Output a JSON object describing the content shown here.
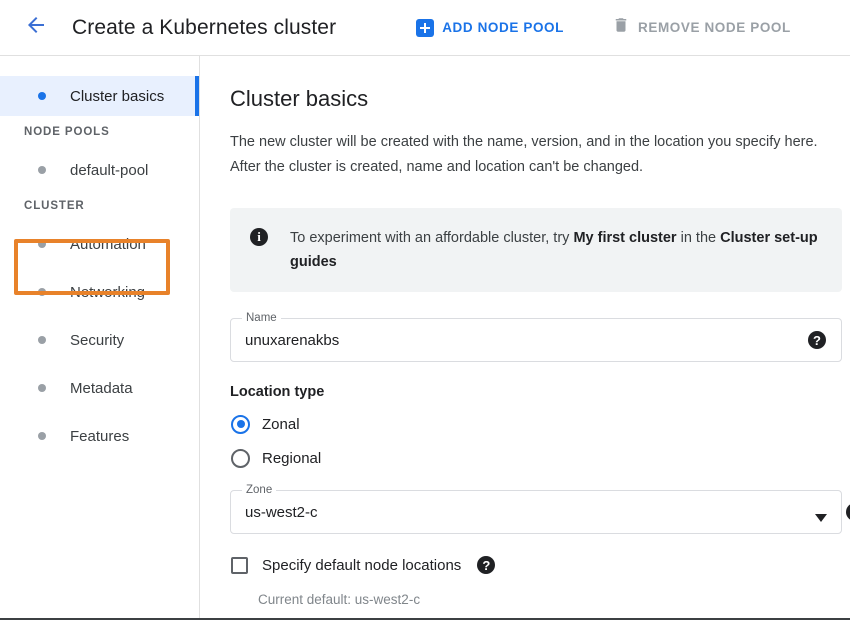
{
  "header": {
    "back_icon": "arrow-left-icon",
    "title": "Create a Kubernetes cluster",
    "add_node_pool_label": "ADD NODE POOL",
    "add_node_pool_icon": "plus-square-icon",
    "remove_node_pool_label": "REMOVE NODE POOL",
    "remove_node_pool_icon": "trash-icon"
  },
  "sidebar": {
    "items": [
      {
        "label": "Cluster basics",
        "active": true
      }
    ],
    "sections": [
      {
        "heading": "NODE POOLS",
        "items": [
          {
            "label": "default-pool"
          }
        ]
      },
      {
        "heading": "CLUSTER",
        "items": [
          {
            "label": "Automation"
          },
          {
            "label": "Networking"
          },
          {
            "label": "Security"
          },
          {
            "label": "Metadata"
          },
          {
            "label": "Features"
          }
        ]
      }
    ]
  },
  "main": {
    "title": "Cluster basics",
    "description": "The new cluster will be created with the name, version, and in the location you specify here. After the cluster is created, name and location can't be changed.",
    "info_banner": {
      "icon": "info-icon",
      "text_part1": "To experiment with an affordable cluster, try ",
      "text_bold1": "My first cluster",
      "text_part2": " in the ",
      "text_bold2": "Cluster set-up guides"
    },
    "name_field": {
      "legend": "Name",
      "value": "unuxarenakbs",
      "placeholder": "Name",
      "help_icon": "help-icon"
    },
    "location_type": {
      "label": "Location type",
      "options": [
        {
          "label": "Zonal",
          "selected": true
        },
        {
          "label": "Regional",
          "selected": false
        }
      ]
    },
    "zone_field": {
      "legend": "Zone",
      "value": "us-west2-c",
      "dropdown_icon": "chevron-down-icon",
      "help_icon": "help-icon"
    },
    "node_locations": {
      "label": "Specify default node locations",
      "checked": false,
      "help_icon": "help-icon",
      "current_default": "Current default: us-west2-c"
    }
  },
  "colors": {
    "accent_blue": "#1a73e8",
    "active_bg": "#e8f0fe",
    "highlight_orange": "#e8822a",
    "banner_bg": "#f1f3f4",
    "disabled_grey": "#9aa0a6"
  }
}
